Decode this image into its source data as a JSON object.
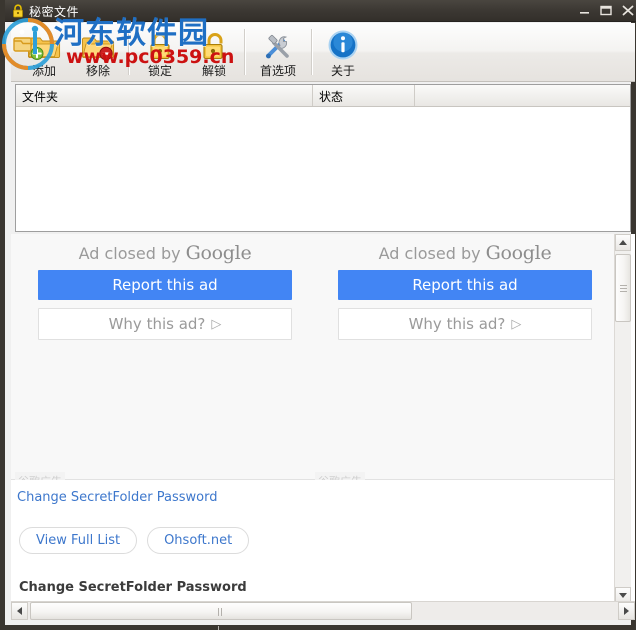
{
  "window": {
    "title": "秘密文件",
    "icon": "padlock-icon",
    "controls": {
      "minimize": "minimize-icon",
      "maximize": "maximize-icon",
      "close": "close-icon"
    }
  },
  "watermark": {
    "site_name": "河东软件园",
    "site_url": "www.pc0359.cn",
    "logo": "site-logo-icon"
  },
  "toolbar": {
    "items": [
      {
        "label": "添加",
        "icon": "folder-add-icon"
      },
      {
        "label": "移除",
        "icon": "folder-remove-icon"
      },
      {
        "label": "锁定",
        "icon": "lock-closed-icon"
      },
      {
        "label": "解锁",
        "icon": "lock-open-icon"
      },
      {
        "label": "首选项",
        "icon": "tools-icon"
      },
      {
        "label": "关于",
        "icon": "info-icon"
      }
    ]
  },
  "listview": {
    "columns": [
      "文件夹",
      "状态",
      ""
    ],
    "rows": []
  },
  "ads": {
    "units": [
      {
        "closed_prefix": "Ad closed by",
        "closed_brand": "Google",
        "report_label": "Report this ad",
        "why_label": "Why this ad?",
        "why_arrow": "▷",
        "tag": "谷歌广告"
      },
      {
        "closed_prefix": "Ad closed by",
        "closed_brand": "Google",
        "report_label": "Report this ad",
        "why_label": "Why this ad?",
        "why_arrow": "▷",
        "tag": "谷歌广告"
      }
    ],
    "accent_blue": "#4285f4"
  },
  "promo": {
    "link": "Change SecretFolder Password",
    "pills": [
      "View Full List",
      "Ohsoft.net"
    ],
    "heading": "Change SecretFolder Password",
    "link_color": "#3d77cc"
  },
  "scrollbars": {
    "vertical": {
      "up": "scroll-up-icon",
      "down": "scroll-down-icon"
    },
    "horizontal": {
      "left": "scroll-left-icon",
      "right": "scroll-right-icon"
    }
  }
}
